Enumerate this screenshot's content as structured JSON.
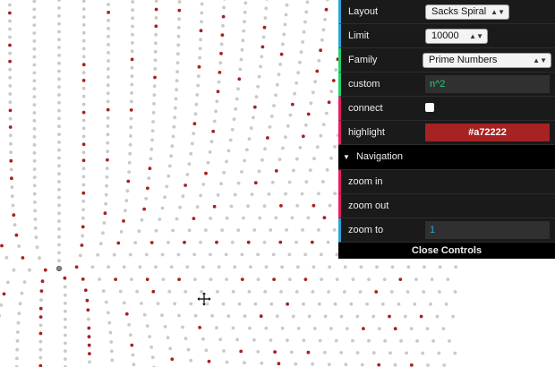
{
  "controls": {
    "layout": {
      "label": "Layout",
      "value": "Sacks Spiral"
    },
    "limit": {
      "label": "Limit",
      "value": "10000"
    },
    "family": {
      "label": "Family",
      "value": "Prime Numbers"
    },
    "custom": {
      "label": "custom",
      "value": "n^2"
    },
    "connect": {
      "label": "connect"
    },
    "highlight": {
      "label": "highlight",
      "value": "#a72222"
    }
  },
  "navigation": {
    "title": "Navigation",
    "zoom_in": "zoom in",
    "zoom_out": "zoom out",
    "zoom_to": {
      "label": "zoom to",
      "value": "1"
    }
  },
  "close_label": "Close Controls",
  "colors": {
    "dot": "#c9c9c9",
    "highlight": "#a72222"
  },
  "icons": {
    "cursor": "move-cursor-icon"
  }
}
